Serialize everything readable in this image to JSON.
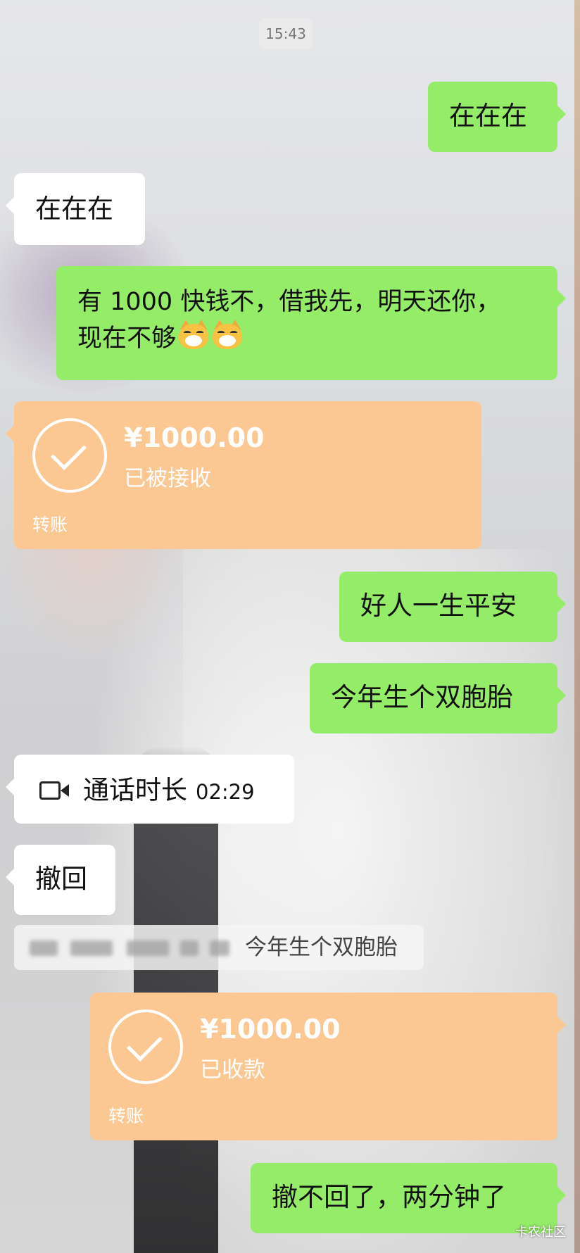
{
  "timestamp": "15:43",
  "messages": {
    "m1": {
      "text": "在在在"
    },
    "m2": {
      "text": "在在在"
    },
    "m3": {
      "line1": "有 1000 快钱不，借我先，明天还你，",
      "line2": "现在不够"
    },
    "t1": {
      "amount": "¥1000.00",
      "status": "已被接收",
      "type": "转账"
    },
    "m4": {
      "text": "好人一生平安"
    },
    "m5": {
      "text": "今年生个双胞胎"
    },
    "call": {
      "label": "通话时长",
      "duration": "02:29"
    },
    "m6": {
      "text": "撤回"
    },
    "recall_notice": {
      "quoted": "今年生个双胞胎"
    },
    "t2": {
      "amount": "¥1000.00",
      "status": "已收款",
      "type": "转账"
    },
    "m7": {
      "text": "撤不回了，两分钟了"
    }
  },
  "watermark": "卡农社区",
  "colors": {
    "sent_bubble": "#95ec69",
    "received_bubble": "#ffffff",
    "transfer_card": "#fbc893"
  },
  "icons": [
    "check-circle-icon",
    "video-call-icon",
    "cat-emoji-icon"
  ]
}
